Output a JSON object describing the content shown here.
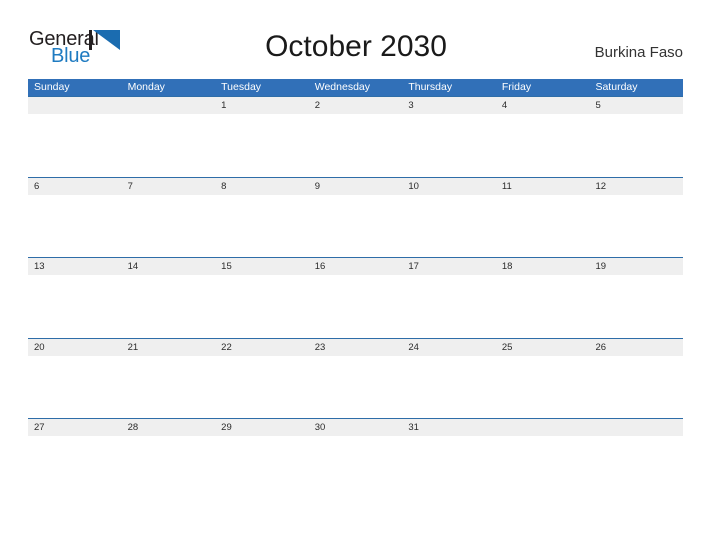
{
  "brand": {
    "name_part1": "General",
    "name_part2": "Blue",
    "mark": "triangle-flag-icon",
    "colors": {
      "text_dark": "#231f20",
      "blue": "#1f7bc1",
      "mark_blue": "#1b6cb0"
    }
  },
  "header": {
    "title": "October 2030",
    "country": "Burkina Faso"
  },
  "calendar": {
    "month": "October",
    "year": "2030",
    "colors": {
      "weekday_header_bg": "#3170b8",
      "weekday_header_text": "#ffffff",
      "date_strip_bg": "#efefef",
      "row_divider": "#2e6da8",
      "day_number_text": "#2b2b2b"
    },
    "weekdays": [
      "Sunday",
      "Monday",
      "Tuesday",
      "Wednesday",
      "Thursday",
      "Friday",
      "Saturday"
    ],
    "weeks": [
      [
        "",
        "",
        "1",
        "2",
        "3",
        "4",
        "5"
      ],
      [
        "6",
        "7",
        "8",
        "9",
        "10",
        "11",
        "12"
      ],
      [
        "13",
        "14",
        "15",
        "16",
        "17",
        "18",
        "19"
      ],
      [
        "20",
        "21",
        "22",
        "23",
        "24",
        "25",
        "26"
      ],
      [
        "27",
        "28",
        "29",
        "30",
        "31",
        "",
        ""
      ]
    ]
  }
}
